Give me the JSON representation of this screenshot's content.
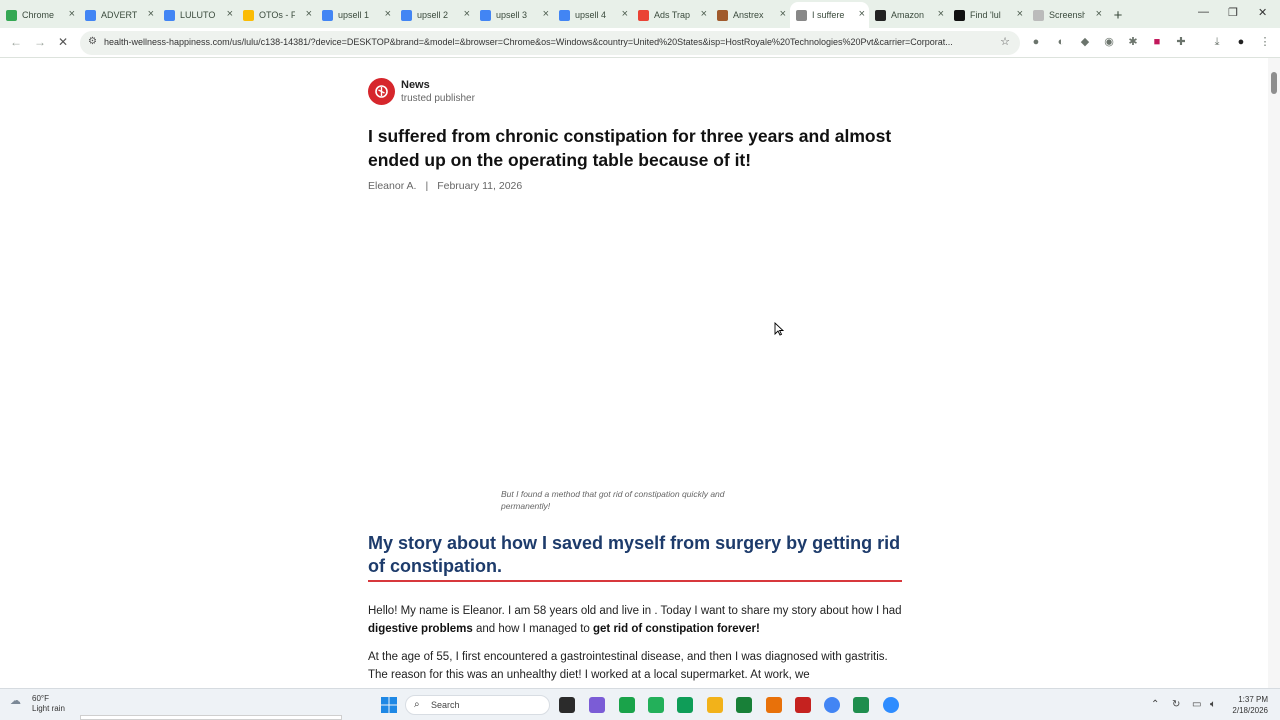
{
  "browser": {
    "tabs": [
      {
        "label": "Chrome",
        "color": "#34a853"
      },
      {
        "label": "ADVERTI",
        "color": "#4285f4"
      },
      {
        "label": "LULUTO",
        "color": "#4285f4"
      },
      {
        "label": "OTOs - F",
        "color": "#fbbc04"
      },
      {
        "label": "upsell 1",
        "color": "#4285f4"
      },
      {
        "label": "upsell 2",
        "color": "#4285f4"
      },
      {
        "label": "upsell 3",
        "color": "#4285f4"
      },
      {
        "label": "upsell 4",
        "color": "#4285f4"
      },
      {
        "label": "Ads Trap",
        "color": "#ea4335"
      },
      {
        "label": "Anstrex",
        "color": "#a05a2c"
      },
      {
        "label": "I suffere",
        "color": "#888888"
      },
      {
        "label": "Amazon",
        "color": "#222222"
      },
      {
        "label": "Find 'lul",
        "color": "#111111"
      },
      {
        "label": "Screensh",
        "color": "#bbbbbb"
      }
    ],
    "url": "health-wellness-happiness.com/us/lulu/c138-14381/?device=DESKTOP&brand=&model=&browser=Chrome&os=Windows&country=United%20States&isp=HostRoyale%20Technologies%20Pvt&carrier=Corporat..."
  },
  "article": {
    "publisher": "News",
    "publisher_tag": "trusted publisher",
    "headline": "I suffered from chronic constipation for three years and almost ended up on the operating table because of it!",
    "author": "Eleanor A.",
    "separator": "|",
    "date": "February 11, 2026",
    "image_caption": "But I found a method that got rid of constipation quickly and permanently!",
    "subheading": "My story about how I saved myself from surgery by getting rid of constipation.",
    "p1_a": "Hello! My name is Eleanor. I am 58 years old and live in . Today I want to share my story about how I had ",
    "p1_b": "digestive problems",
    "p1_c": " and how I managed to ",
    "p1_d": "get rid of constipation forever!",
    "p2": "At the age of 55, I first encountered a gastrointestinal disease, and then I was diagnosed with gastritis. The reason for this was an unhealthy diet! I worked at a local supermarket. At work, we"
  },
  "taskbar": {
    "temp": "60°F",
    "weather": "Light rain",
    "search_placeholder": "Search",
    "time": "1:37 PM",
    "date": "2/18/2026"
  }
}
